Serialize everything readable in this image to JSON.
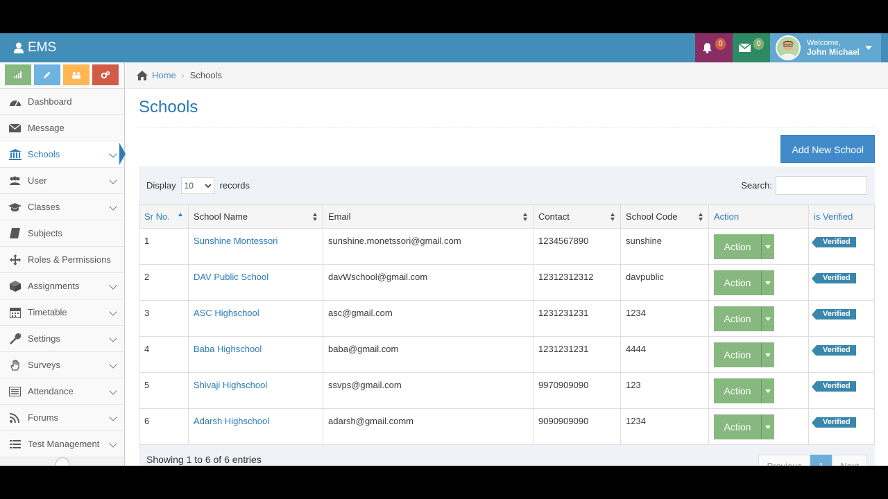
{
  "app": {
    "brand": "EMS"
  },
  "navbar": {
    "notifications_count": "0",
    "messages_count": "0",
    "welcome_label": "Welcome,",
    "user_name": "John Michael"
  },
  "sidebar": {
    "items": [
      {
        "label": "Dashboard",
        "icon": "dashboard-icon",
        "submenu": false
      },
      {
        "label": "Message",
        "icon": "envelope-icon",
        "submenu": false
      },
      {
        "label": "Schools",
        "icon": "university-icon",
        "submenu": true,
        "active": true
      },
      {
        "label": "User",
        "icon": "users-icon",
        "submenu": true
      },
      {
        "label": "Classes",
        "icon": "graduation-cap-icon",
        "submenu": true
      },
      {
        "label": "Subjects",
        "icon": "book-icon",
        "submenu": false
      },
      {
        "label": "Roles & Permissions",
        "icon": "arrows-icon",
        "submenu": false
      },
      {
        "label": "Assignments",
        "icon": "cube-icon",
        "submenu": true
      },
      {
        "label": "Timetable",
        "icon": "calendar-icon",
        "submenu": true
      },
      {
        "label": "Settings",
        "icon": "wrench-icon",
        "submenu": true
      },
      {
        "label": "Surveys",
        "icon": "hand-icon",
        "submenu": true
      },
      {
        "label": "Attendance",
        "icon": "list-alt-icon",
        "submenu": true
      },
      {
        "label": "Forums",
        "icon": "rss-icon",
        "submenu": true
      },
      {
        "label": "Test Management",
        "icon": "list-icon",
        "submenu": true
      }
    ]
  },
  "breadcrumb": {
    "home": "Home",
    "current": "Schools"
  },
  "page": {
    "title": "Schools",
    "add_button": "Add New School"
  },
  "table": {
    "display_label": "Display",
    "page_size": "10",
    "records_label": "records",
    "search_label": "Search:",
    "columns": [
      "Sr No.",
      "School Name",
      "Email",
      "Contact",
      "School Code",
      "Action",
      "is Verified"
    ],
    "rows": [
      {
        "sr": "1",
        "name": "Sunshine Montessori",
        "email": "sunshine.monetssori@gmail.com",
        "contact": "1234567890",
        "code": "sunshine",
        "action": "Action",
        "verified": "Verified"
      },
      {
        "sr": "2",
        "name": "DAV Public School",
        "email": "davWschool@gmail.com",
        "contact": "12312312312",
        "code": "davpublic",
        "action": "Action",
        "verified": "Verified"
      },
      {
        "sr": "3",
        "name": "ASC Highschool",
        "email": "asc@gmail.com",
        "contact": "1231231231",
        "code": "1234",
        "action": "Action",
        "verified": "Verified"
      },
      {
        "sr": "4",
        "name": "Baba Highschool",
        "email": "baba@gmail.com",
        "contact": "1231231231",
        "code": "4444",
        "action": "Action",
        "verified": "Verified"
      },
      {
        "sr": "5",
        "name": "Shivaji Highschool",
        "email": "ssvps@gmail.com",
        "contact": "9970909090",
        "code": "123",
        "action": "Action",
        "verified": "Verified"
      },
      {
        "sr": "6",
        "name": "Adarsh Highschool",
        "email": "adarsh@gmail.comm",
        "contact": "9090909090",
        "code": "1234",
        "action": "Action",
        "verified": "Verified"
      }
    ],
    "info": "Showing 1 to 6 of 6 entries",
    "pager": {
      "previous": "Previous",
      "current": "1",
      "next": "Next"
    }
  },
  "colors": {
    "navbar": "#438eb9",
    "bell_bg": "#892e65",
    "mail_bg": "#2e8965",
    "user_bg": "#62a8d1",
    "action_green": "#87b87f",
    "link_blue": "#2a7bb5",
    "add_button": "#428bca",
    "verified_badge": "#3a87ad"
  }
}
